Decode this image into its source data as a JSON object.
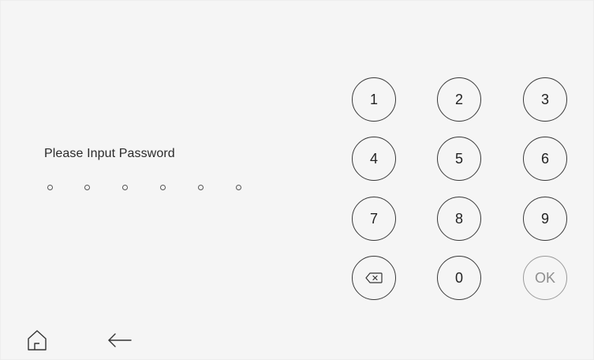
{
  "prompt": {
    "text": "Please Input Password"
  },
  "password": {
    "length": 6,
    "entered": 0
  },
  "keypad": {
    "keys": [
      {
        "id": "1",
        "label": "1"
      },
      {
        "id": "2",
        "label": "2"
      },
      {
        "id": "3",
        "label": "3"
      },
      {
        "id": "4",
        "label": "4"
      },
      {
        "id": "5",
        "label": "5"
      },
      {
        "id": "6",
        "label": "6"
      },
      {
        "id": "7",
        "label": "7"
      },
      {
        "id": "8",
        "label": "8"
      },
      {
        "id": "9",
        "label": "9"
      },
      {
        "id": "backspace",
        "label": "",
        "icon": "backspace-icon"
      },
      {
        "id": "0",
        "label": "0"
      },
      {
        "id": "ok",
        "label": "OK"
      }
    ]
  },
  "nav": {
    "home_icon": "home-icon",
    "back_icon": "back-arrow-icon"
  },
  "colors": {
    "background": "#f5f5f5",
    "key_border": "#3a3a3a",
    "ok_disabled": "#8e8e8e"
  }
}
